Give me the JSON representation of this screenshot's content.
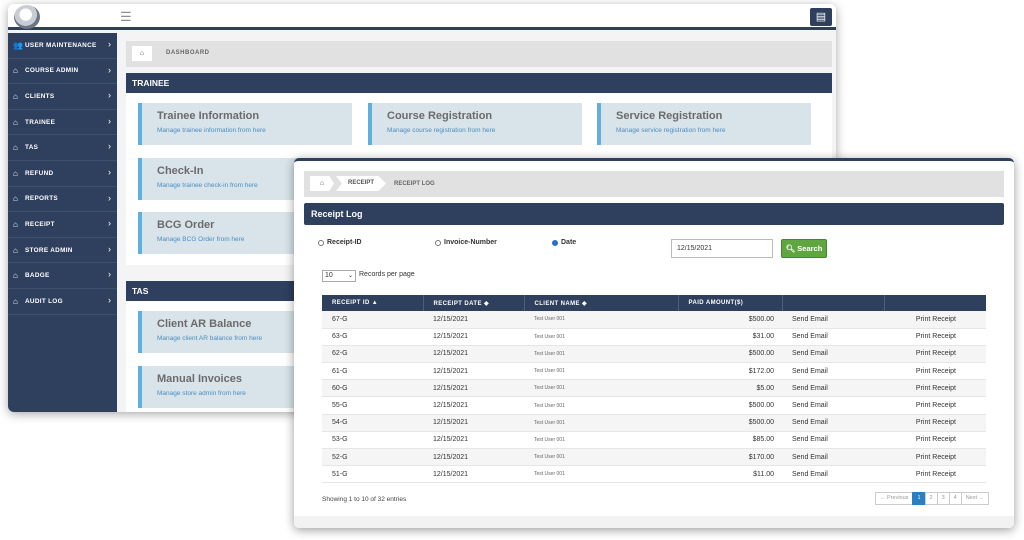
{
  "sidebar": {
    "items": [
      {
        "label": "USER MAINTENANCE",
        "icon": "users-icon"
      },
      {
        "label": "COURSE ADMIN",
        "icon": "bank-icon"
      },
      {
        "label": "CLIENTS",
        "icon": "bank-icon"
      },
      {
        "label": "TRAINEE",
        "icon": "bank-icon"
      },
      {
        "label": "TAS",
        "icon": "bank-icon"
      },
      {
        "label": "REFUND",
        "icon": "bank-icon"
      },
      {
        "label": "REPORTS",
        "icon": "bank-icon"
      },
      {
        "label": "RECEIPT",
        "icon": "bank-icon"
      },
      {
        "label": "STORE ADMIN",
        "icon": "bank-icon"
      },
      {
        "label": "BADGE",
        "icon": "bank-icon"
      },
      {
        "label": "AUDIT LOG",
        "icon": "bank-icon"
      }
    ]
  },
  "back": {
    "breadcrumb": "DASHBOARD",
    "trainee_section": "TRAINEE",
    "tas_section": "TAS",
    "cards": [
      {
        "title": "Trainee Information",
        "sub": "Manage trainee information from here"
      },
      {
        "title": "Course Registration",
        "sub": "Manage course registration from here"
      },
      {
        "title": "Service Registration",
        "sub": "Manage service registration from here"
      },
      {
        "title": "Check-In",
        "sub": "Manage trainee check-in from here"
      },
      {
        "title": "BCG Order",
        "sub": "Manage BCG Order from here"
      },
      {
        "title": "Client AR Balance",
        "sub": "Manage client AR balance from here"
      },
      {
        "title": "Manual Invoices",
        "sub": "Manage store admin from here"
      }
    ]
  },
  "front": {
    "breadcrumb": {
      "receipt": "RECEIPT",
      "current": "RECEIPT LOG"
    },
    "title": "Receipt Log",
    "filters": {
      "receipt_id": "Receipt-ID",
      "invoice_number": "Invoice-Number",
      "date": "Date",
      "selected": "Date"
    },
    "date_value": "12/15/2021",
    "search_label": "Search",
    "records_per_page": {
      "value": "10",
      "label": "Records per page"
    },
    "columns": [
      "RECEIPT ID",
      "RECEIPT DATE",
      "CLIENT NAME",
      "PAID AMOUNT($)"
    ],
    "sort_indicators": [
      "▲",
      "◆",
      "◆"
    ],
    "rows": [
      {
        "id": "67-G",
        "date": "12/15/2021",
        "client": "Test User 001",
        "amount": "$500.00",
        "email": "Send Email",
        "print": "Print Receipt"
      },
      {
        "id": "63-G",
        "date": "12/15/2021",
        "client": "Test User 001",
        "amount": "$31.00",
        "email": "Send Email",
        "print": "Print Receipt"
      },
      {
        "id": "62-G",
        "date": "12/15/2021",
        "client": "Test User 001",
        "amount": "$500.00",
        "email": "Send Email",
        "print": "Print Receipt"
      },
      {
        "id": "61-G",
        "date": "12/15/2021",
        "client": "Test User 001",
        "amount": "$172.00",
        "email": "Send Email",
        "print": "Print Receipt"
      },
      {
        "id": "60-G",
        "date": "12/15/2021",
        "client": "Test User 001",
        "amount": "$5.00",
        "email": "Send Email",
        "print": "Print Receipt"
      },
      {
        "id": "55-G",
        "date": "12/15/2021",
        "client": "Test User 001",
        "amount": "$500.00",
        "email": "Send Email",
        "print": "Print Receipt"
      },
      {
        "id": "54-G",
        "date": "12/15/2021",
        "client": "Test User 001",
        "amount": "$500.00",
        "email": "Send Email",
        "print": "Print Receipt"
      },
      {
        "id": "53-G",
        "date": "12/15/2021",
        "client": "Test User 001",
        "amount": "$85.00",
        "email": "Send Email",
        "print": "Print Receipt"
      },
      {
        "id": "52-G",
        "date": "12/15/2021",
        "client": "Test User 001",
        "amount": "$170.00",
        "email": "Send Email",
        "print": "Print Receipt"
      },
      {
        "id": "51-G",
        "date": "12/15/2021",
        "client": "Test User 001",
        "amount": "$11.00",
        "email": "Send Email",
        "print": "Print Receipt"
      }
    ],
    "showing": "Showing 1 to 10 of 32 entries",
    "pagination": [
      "← Previous",
      "1",
      "2",
      "3",
      "4",
      "Next →"
    ],
    "active_page": "1"
  },
  "colors": {
    "navy": "#2f3f5e",
    "accent": "#5fb0dc",
    "link": "#3a82c4",
    "search_green": "#5fa640"
  }
}
